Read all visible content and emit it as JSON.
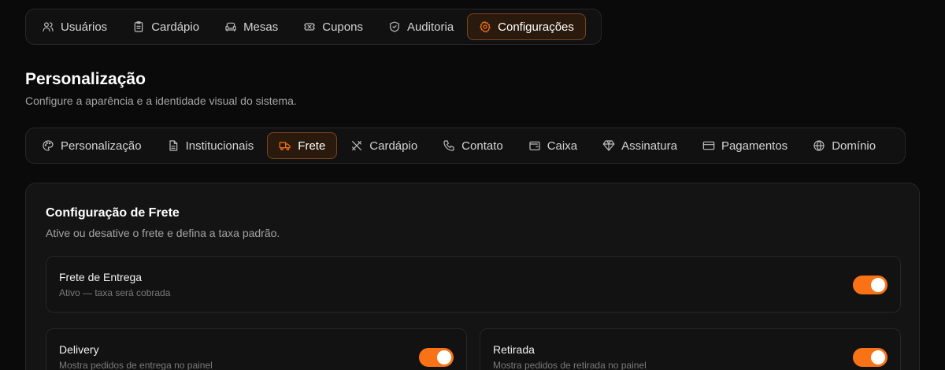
{
  "topnav": {
    "items": [
      {
        "label": "Usuários",
        "icon": "users-icon"
      },
      {
        "label": "Cardápio",
        "icon": "clipboard-icon"
      },
      {
        "label": "Mesas",
        "icon": "sofa-icon"
      },
      {
        "label": "Cupons",
        "icon": "ticket-icon"
      },
      {
        "label": "Auditoria",
        "icon": "shield-icon"
      },
      {
        "label": "Configurações",
        "icon": "gear-icon",
        "active": true
      }
    ]
  },
  "page": {
    "title": "Personalização",
    "subtitle": "Configure a aparência e a identidade visual do sistema."
  },
  "subtabs": {
    "items": [
      {
        "label": "Personalização",
        "icon": "palette-icon"
      },
      {
        "label": "Institucionais",
        "icon": "document-icon"
      },
      {
        "label": "Frete",
        "icon": "truck-icon",
        "active": true
      },
      {
        "label": "Cardápio",
        "icon": "utensils-icon"
      },
      {
        "label": "Contato",
        "icon": "phone-icon"
      },
      {
        "label": "Caixa",
        "icon": "wallet-icon"
      },
      {
        "label": "Assinatura",
        "icon": "gem-icon"
      },
      {
        "label": "Pagamentos",
        "icon": "credit-card-icon"
      },
      {
        "label": "Domínio",
        "icon": "globe-icon"
      }
    ]
  },
  "card": {
    "title": "Configuração de Frete",
    "description": "Ative ou desative o frete e defina a taxa padrão.",
    "rows": {
      "frete": {
        "title": "Frete de Entrega",
        "subtitle": "Ativo — taxa será cobrada",
        "enabled": true
      },
      "delivery": {
        "title": "Delivery",
        "subtitle": "Mostra pedidos de entrega no painel",
        "enabled": true
      },
      "retirada": {
        "title": "Retirada",
        "subtitle": "Mostra pedidos de retirada no painel",
        "enabled": true
      }
    }
  },
  "colors": {
    "accent": "#f97316",
    "background": "#0a0a0a",
    "active_tab_bg": "#2a1a0e"
  }
}
